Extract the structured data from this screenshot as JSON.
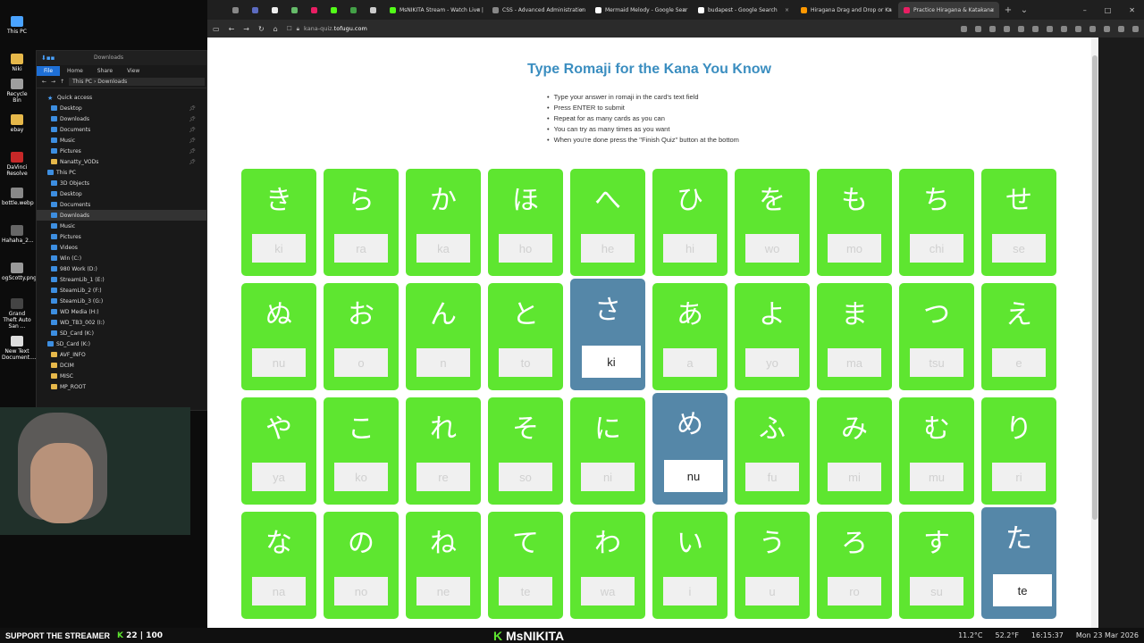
{
  "desktop": {
    "icons": [
      "This PC",
      "Niki",
      "Recycle Bin",
      "ebay",
      "DaVinci Resolve",
      "bottle.webp",
      "Hahaha_2...",
      "ogScotty.png",
      "Grand Theft Auto San ...",
      "New Text Document...."
    ]
  },
  "explorer": {
    "title": "Downloads",
    "ribbon": [
      "File",
      "Home",
      "Share",
      "View"
    ],
    "address": [
      "This PC",
      "Downloads"
    ],
    "tree": [
      {
        "label": "Quick access",
        "type": "star"
      },
      {
        "label": "Desktop",
        "type": "blue",
        "pin": true
      },
      {
        "label": "Downloads",
        "type": "blue",
        "pin": true
      },
      {
        "label": "Documents",
        "type": "blue",
        "pin": true
      },
      {
        "label": "Music",
        "type": "blue",
        "pin": true
      },
      {
        "label": "Pictures",
        "type": "blue",
        "pin": true
      },
      {
        "label": "Nanatty_VODs",
        "type": "folder",
        "pin": true
      },
      {
        "label": "This PC",
        "type": "blue"
      },
      {
        "label": "3D Objects",
        "type": "blue"
      },
      {
        "label": "Desktop",
        "type": "blue"
      },
      {
        "label": "Documents",
        "type": "blue"
      },
      {
        "label": "Downloads",
        "type": "blue",
        "selected": true
      },
      {
        "label": "Music",
        "type": "blue"
      },
      {
        "label": "Pictures",
        "type": "blue"
      },
      {
        "label": "Videos",
        "type": "blue"
      },
      {
        "label": "Win (C:)",
        "type": "blue"
      },
      {
        "label": "980 Work (D:)",
        "type": "blue"
      },
      {
        "label": "StreamLib_1 (E:)",
        "type": "blue"
      },
      {
        "label": "SteamLib_2 (F:)",
        "type": "blue"
      },
      {
        "label": "SteamLib_3 (G:)",
        "type": "blue"
      },
      {
        "label": "WD Media (H:)",
        "type": "blue"
      },
      {
        "label": "WD_TB3_002 (I:)",
        "type": "blue"
      },
      {
        "label": "SD_Card (K:)",
        "type": "blue"
      },
      {
        "label": "SD_Card (K:)",
        "type": "blue"
      },
      {
        "label": "AVF_INFO",
        "type": "folder"
      },
      {
        "label": "DCIM",
        "type": "folder"
      },
      {
        "label": "MISC",
        "type": "folder"
      },
      {
        "label": "MP_ROOT",
        "type": "folder"
      }
    ]
  },
  "browser": {
    "tabs": [
      {
        "label": "",
        "color": "#888888"
      },
      {
        "label": "",
        "color": "#5c6bc0"
      },
      {
        "label": "",
        "color": "#eeeeee"
      },
      {
        "label": "",
        "color": "#66bb6a"
      },
      {
        "label": "",
        "color": "#e91e63"
      },
      {
        "label": "",
        "color": "#53fc18"
      },
      {
        "label": "",
        "color": "#43a047"
      },
      {
        "label": "",
        "color": "#cccccc"
      },
      {
        "label": "MsNIKITA Stream - Watch Live |",
        "color": "#53fc18",
        "wide": true
      },
      {
        "label": "CSS - Advanced Administration",
        "color": "#888888",
        "wide": true
      },
      {
        "label": "Mermaid Melody - Google Sear",
        "color": "#ffffff",
        "wide": true
      },
      {
        "label": "budapest - Google Search",
        "color": "#ffffff",
        "wide": true
      },
      {
        "label": "Hiragana Drag and Drop or Ka",
        "color": "#ff9800",
        "wide": true
      },
      {
        "label": "Practice Hiragana & Katakana",
        "color": "#e91e63",
        "wide": true,
        "active": true
      }
    ],
    "url_prefix": "kana-quiz.",
    "url_domain": "tofugu.com"
  },
  "page": {
    "title": "Type Romaji for the Kana You Know",
    "instructions": [
      "Type your answer in romaji in the card's text field",
      "Press ENTER to submit",
      "Repeat for as many cards as you can",
      "You can try as many times as you want",
      "When you're done press the \"Finish Quiz\" button at the bottom"
    ],
    "cards": [
      {
        "kana": "き",
        "hint": "ki",
        "value": ""
      },
      {
        "kana": "ら",
        "hint": "ra",
        "value": ""
      },
      {
        "kana": "か",
        "hint": "ka",
        "value": ""
      },
      {
        "kana": "ほ",
        "hint": "ho",
        "value": ""
      },
      {
        "kana": "へ",
        "hint": "he",
        "value": ""
      },
      {
        "kana": "ひ",
        "hint": "hi",
        "value": ""
      },
      {
        "kana": "を",
        "hint": "wo",
        "value": ""
      },
      {
        "kana": "も",
        "hint": "mo",
        "value": ""
      },
      {
        "kana": "ち",
        "hint": "chi",
        "value": ""
      },
      {
        "kana": "せ",
        "hint": "se",
        "value": ""
      },
      {
        "kana": "ぬ",
        "hint": "nu",
        "value": ""
      },
      {
        "kana": "お",
        "hint": "o",
        "value": ""
      },
      {
        "kana": "ん",
        "hint": "n",
        "value": ""
      },
      {
        "kana": "と",
        "hint": "to",
        "value": ""
      },
      {
        "kana": "さ",
        "hint": "",
        "value": "ki",
        "wrong": true
      },
      {
        "kana": "あ",
        "hint": "a",
        "value": ""
      },
      {
        "kana": "よ",
        "hint": "yo",
        "value": ""
      },
      {
        "kana": "ま",
        "hint": "ma",
        "value": ""
      },
      {
        "kana": "つ",
        "hint": "tsu",
        "value": ""
      },
      {
        "kana": "え",
        "hint": "e",
        "value": ""
      },
      {
        "kana": "や",
        "hint": "ya",
        "value": ""
      },
      {
        "kana": "こ",
        "hint": "ko",
        "value": ""
      },
      {
        "kana": "れ",
        "hint": "re",
        "value": ""
      },
      {
        "kana": "そ",
        "hint": "so",
        "value": ""
      },
      {
        "kana": "に",
        "hint": "ni",
        "value": ""
      },
      {
        "kana": "め",
        "hint": "",
        "value": "nu",
        "wrong": true
      },
      {
        "kana": "ふ",
        "hint": "fu",
        "value": ""
      },
      {
        "kana": "み",
        "hint": "mi",
        "value": ""
      },
      {
        "kana": "む",
        "hint": "mu",
        "value": ""
      },
      {
        "kana": "り",
        "hint": "ri",
        "value": ""
      },
      {
        "kana": "な",
        "hint": "na",
        "value": ""
      },
      {
        "kana": "の",
        "hint": "no",
        "value": ""
      },
      {
        "kana": "ね",
        "hint": "ne",
        "value": ""
      },
      {
        "kana": "て",
        "hint": "te",
        "value": ""
      },
      {
        "kana": "わ",
        "hint": "wa",
        "value": ""
      },
      {
        "kana": "い",
        "hint": "i",
        "value": ""
      },
      {
        "kana": "う",
        "hint": "u",
        "value": ""
      },
      {
        "kana": "ろ",
        "hint": "ro",
        "value": ""
      },
      {
        "kana": "す",
        "hint": "su",
        "value": ""
      },
      {
        "kana": "た",
        "hint": "",
        "value": "te",
        "wrong": true
      }
    ],
    "colors": {
      "correct": "#5ee630",
      "wrong": "#5587a8",
      "title": "#3b8ec0"
    }
  },
  "taskbar": {
    "support": "SUPPORT THE STREAMER",
    "k_symbol": "K",
    "count": "22",
    "count2": "100",
    "brand": "MsNIKITA",
    "weather": "11.2°C",
    "temp": "52.2°F",
    "time": "16:15:37",
    "date": "Mon 23 Mar 2026"
  }
}
